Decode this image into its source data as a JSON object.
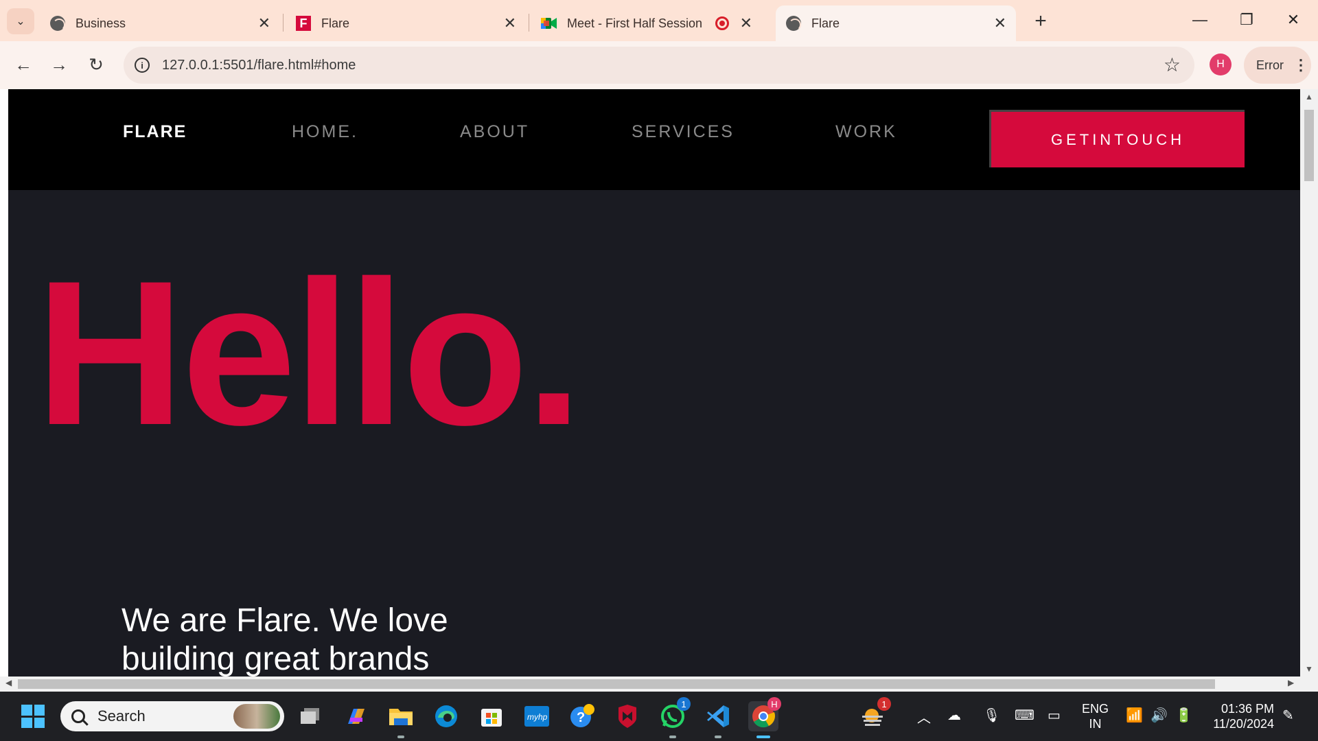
{
  "browser": {
    "tabs": [
      {
        "title": "Business",
        "favicon": "globe-icon",
        "active": false
      },
      {
        "title": "Flare",
        "favicon": "flare-favicon-icon",
        "active": false
      },
      {
        "title": "Meet - First Half Session",
        "favicon": "google-meet-icon",
        "active": false,
        "recording": true
      },
      {
        "title": "Flare",
        "favicon": "globe-icon",
        "active": true
      }
    ],
    "new_tab_symbol": "+",
    "close_symbol": "✕",
    "url": "127.0.0.1:5501/flare.html#home",
    "profile_initial": "H",
    "error_label": "Error"
  },
  "site": {
    "logo": "FLARE",
    "nav": [
      "HOME.",
      "ABOUT",
      "SERVICES",
      "WORK"
    ],
    "cta": "GETINTOUCH",
    "hero_title": "Hello.",
    "hero_subtitle": "We are Flare. We love building great brands",
    "accent_color": "#d50a3c",
    "background_color": "#1a1b22"
  },
  "taskbar": {
    "search_placeholder": "Search",
    "whatsapp_badge": "1",
    "weather_badge": "1",
    "chrome_profile_initial": "H",
    "language": "ENG",
    "region": "IN",
    "time": "01:36 PM",
    "date": "11/20/2024"
  }
}
